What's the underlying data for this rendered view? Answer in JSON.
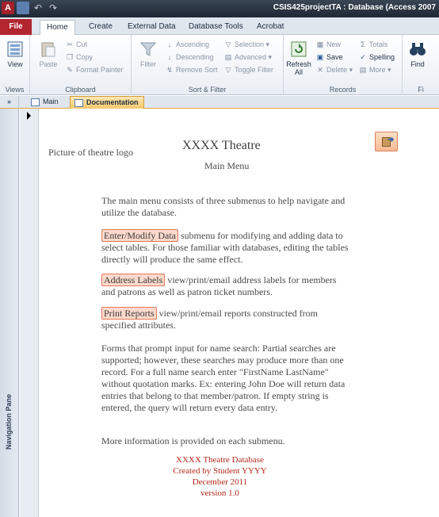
{
  "titlebar": {
    "app_icon": "A",
    "title": "CSIS425projectTA : Database (Access 2007"
  },
  "ribbon_tabs": [
    "File",
    "Home",
    "Create",
    "External Data",
    "Database Tools",
    "Acrobat"
  ],
  "ribbon": {
    "views": {
      "view_label": "View",
      "group_label": "Views"
    },
    "clipboard": {
      "paste_label": "Paste",
      "cut": "Cut",
      "copy": "Copy",
      "format_painter": "Format Painter",
      "group_label": "Clipboard"
    },
    "sort_filter": {
      "filter_label": "Filter",
      "ascending": "Ascending",
      "descending": "Descending",
      "remove_sort": "Remove Sort",
      "selection": "Selection",
      "advanced": "Advanced",
      "toggle_filter": "Toggle Filter",
      "group_label": "Sort & Filter"
    },
    "records": {
      "refresh_label": "Refresh All",
      "new": "New",
      "save": "Save",
      "delete": "Delete",
      "totals": "Totals",
      "spelling": "Spelling",
      "more": "More",
      "group_label": "Records"
    },
    "find": {
      "find_label": "Find",
      "group_label": "Fi"
    }
  },
  "doc_tabs": [
    {
      "label": "Main",
      "active": false
    },
    {
      "label": "Documentation",
      "active": true
    }
  ],
  "nav_pane": {
    "toggle": "»",
    "label": "Navigation Pane"
  },
  "form": {
    "logo_placeholder": "Picture of theatre logo",
    "title": "XXXX Theatre",
    "subtitle": "Main Menu",
    "intro": "The main menu consists of three submenus to help navigate and utilize the database.",
    "enter_modify": {
      "button": "Enter/Modify Data",
      "text": " submenu for modifying and adding data to select tables. For those familiar with databases, editing the tables directly will produce the same effect."
    },
    "address_labels": {
      "button": "Address Labels",
      "text": " view/print/email address labels for members and patrons as well as patron ticket numbers."
    },
    "print_reports": {
      "button": "Print Reports",
      "text": " view/print/email reports constructed from specified attributes."
    },
    "forms_note": "Forms that prompt input for name search: Partial searches are supported; however, these searches may produce more than one record. For a full name search enter \"FirstName LastName\" without quotation marks. Ex: entering John Doe will return data entries that belong to that member/patron. If empty string is entered, the query will return every data entry.",
    "more_info": "More information is provided on each submenu.",
    "footer": {
      "line1": "XXXX Theatre Database",
      "line2": "Created by Student YYYY",
      "line3": "December 2011",
      "line4": "version 1.0"
    }
  },
  "colors": {
    "file_tab": "#b3252f",
    "active_doc_tab": "#f6c86c",
    "button_highlight": "#fbd9cc",
    "footer_text": "#b52a1c"
  }
}
